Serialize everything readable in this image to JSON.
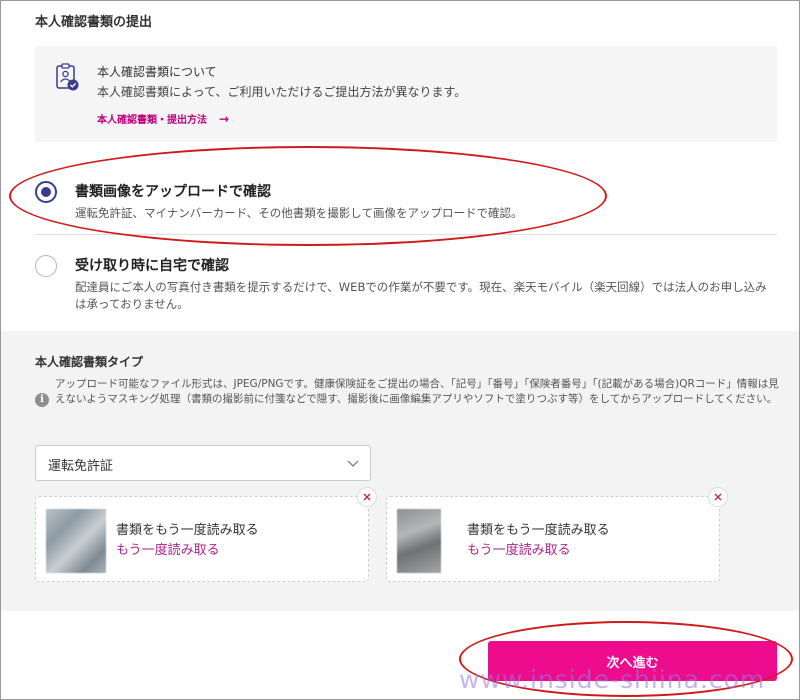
{
  "header": {
    "title": "本人確認書類の提出"
  },
  "info_box": {
    "heading": "本人確認書類について",
    "description": "本人確認書類によって、ご利用いただけるご提出方法が異なります。",
    "link_label": "本人確認書類・提出方法",
    "link_arrow": "→"
  },
  "options": [
    {
      "title": "書類画像をアップロードで確認",
      "description": "運転免許証、マイナンバーカード、その他書類を撮影して画像をアップロードで確認。",
      "selected": true
    },
    {
      "title": "受け取り時に自宅で確認",
      "description": "配達員にご本人の写真付き書類を提示するだけで、WEBでの作業が不要です。現在、楽天モバイル（楽天回線）では法人のお申し込みは承っておりません。",
      "selected": false
    }
  ],
  "doc_type": {
    "title": "本人確認書類タイプ",
    "notice_icon": "i",
    "notice": "アップロード可能なファイル形式は、JPEG/PNGです。健康保険証をご提出の場合、「記号」「番号」「保険者番号」「(記載がある場合)QRコード」情報は見えないようマスキング処理（書類の撮影前に付箋などで隠す、撮影後に画像編集アプリやソフトで塗りつぶす等）をしてからアップロードしてください。",
    "selected_value": "運転免許証"
  },
  "uploads": [
    {
      "title": "書類をもう一度読み取る",
      "link": "もう一度読み取る"
    },
    {
      "title": "書類をもう一度読み取る",
      "link": "もう一度読み取る"
    }
  ],
  "footer": {
    "next_label": "次へ進む"
  },
  "watermark": "www.inside-shiina.com",
  "colors": {
    "accent": "#ee0c8e",
    "link": "#bf0080",
    "radio_selected": "#3b3b8f",
    "annotation": "#d01919"
  }
}
